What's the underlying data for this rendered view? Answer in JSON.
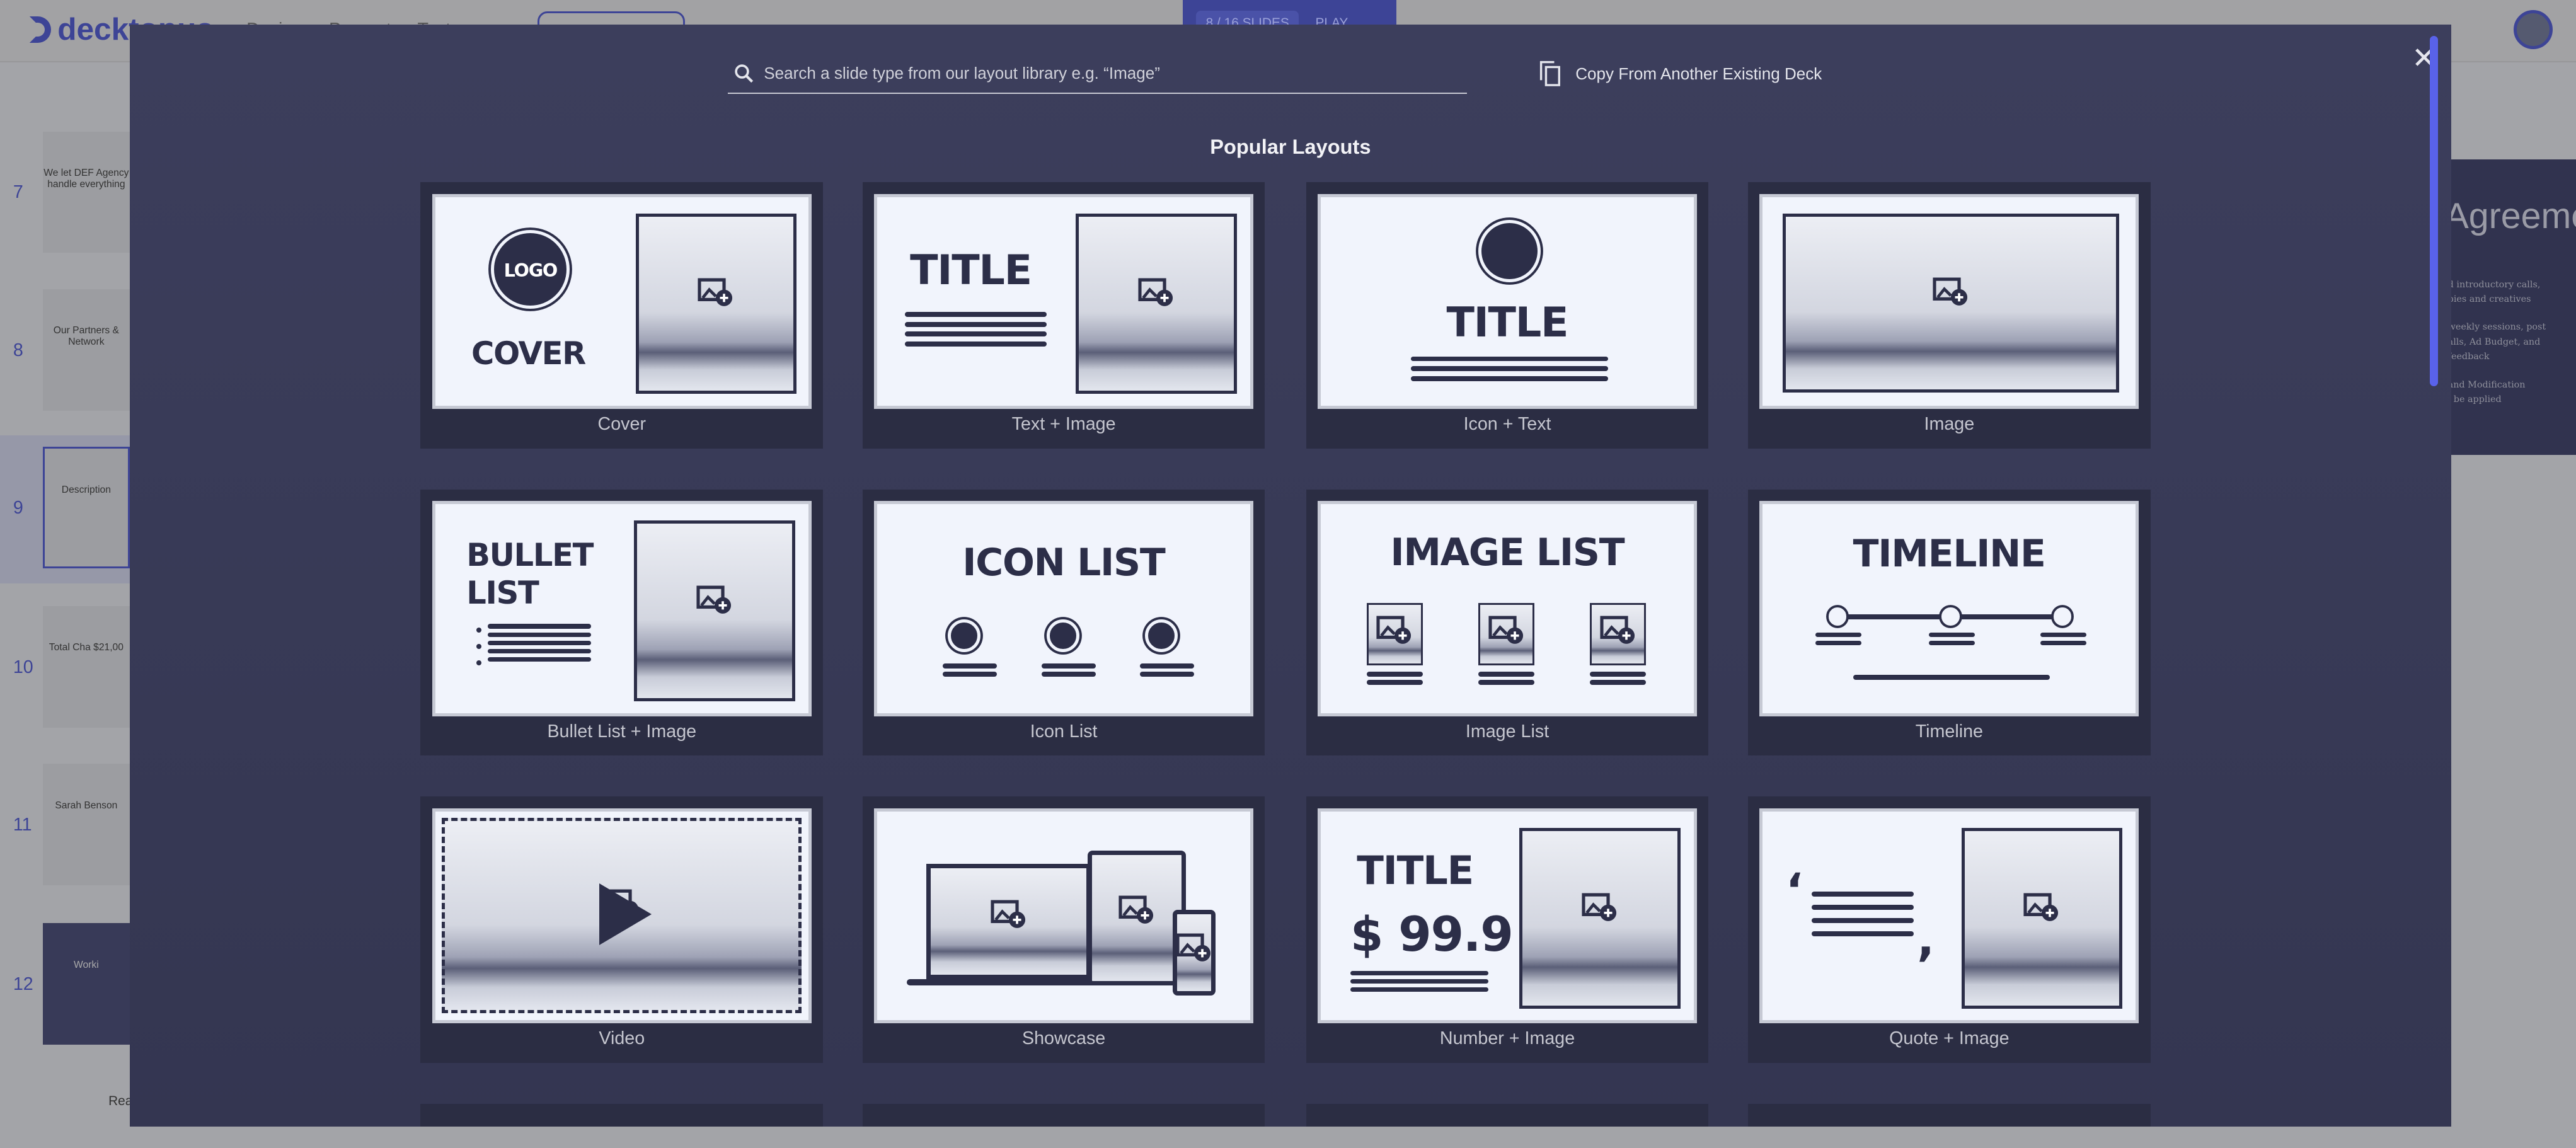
{
  "app": {
    "logo": "decktopus",
    "nav": [
      "Design",
      "Present",
      "Text"
    ],
    "slides_count": "8 / 16 SLIDES",
    "play": "PLAY"
  },
  "sidebar": {
    "slides": [
      {
        "num": "7",
        "text": "We let DEF Agency handle everything"
      },
      {
        "num": "8",
        "text": "Our Partners & Network"
      },
      {
        "num": "9",
        "text": "Description"
      },
      {
        "num": "10",
        "text": "Total Cha $21,00"
      },
      {
        "num": "11",
        "text": "Sarah Benson"
      },
      {
        "num": "12",
        "text": "Worki"
      }
    ],
    "partial": "Rea"
  },
  "preview": {
    "title": "Agreeme",
    "lines": [
      "d introductory calls,",
      "pies and creatives",
      "weekly sessions, post",
      "alls, Ad Budget, and feedback",
      "and Modification",
      "l be applied"
    ]
  },
  "modal": {
    "search_placeholder": "Search a slide type from our layout library e.g. “Image”",
    "copy_label": "Copy From Another Existing Deck",
    "section_title": "Popular Layouts",
    "accent": "#5962ea",
    "layouts": [
      {
        "label": "Cover",
        "thumb": [
          "LOGO",
          "COVER"
        ]
      },
      {
        "label": "Text + Image",
        "thumb": [
          "TITLE"
        ]
      },
      {
        "label": "Icon + Text",
        "thumb": [
          "TITLE"
        ]
      },
      {
        "label": "Image",
        "thumb": []
      },
      {
        "label": "Bullet List + Image",
        "thumb": [
          "BULLET",
          "LIST"
        ]
      },
      {
        "label": "Icon List",
        "thumb": [
          "ICON LIST"
        ]
      },
      {
        "label": "Image List",
        "thumb": [
          "IMAGE LIST"
        ]
      },
      {
        "label": "Timeline",
        "thumb": [
          "TIMELINE"
        ]
      },
      {
        "label": "Video",
        "thumb": []
      },
      {
        "label": "Showcase",
        "thumb": []
      },
      {
        "label": "Number + Image",
        "thumb": [
          "TITLE",
          "$ 99.9"
        ]
      },
      {
        "label": "Quote + Image",
        "thumb": []
      }
    ]
  }
}
